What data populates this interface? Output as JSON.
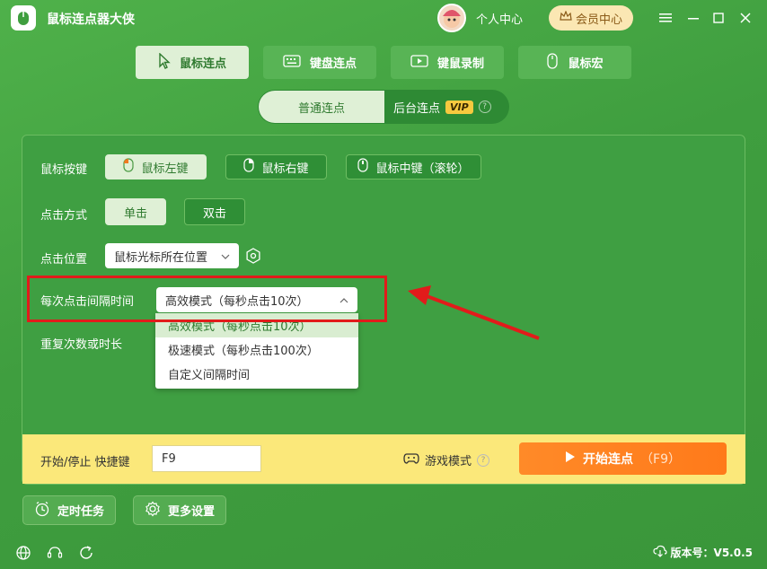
{
  "app": {
    "title": "鼠标连点器大侠"
  },
  "header": {
    "personal_center": "个人中心",
    "vip_center": "会员中心"
  },
  "main_tabs": [
    {
      "label": "鼠标连点",
      "icon": "cursor-icon",
      "active": true
    },
    {
      "label": "键盘连点",
      "icon": "keyboard-icon",
      "active": false
    },
    {
      "label": "键鼠录制",
      "icon": "video-icon",
      "active": false
    },
    {
      "label": "鼠标宏",
      "icon": "mouse-icon",
      "active": false
    }
  ],
  "sub_tabs": {
    "normal": "普通连点",
    "background": "后台连点",
    "vip_badge": "VIP"
  },
  "panel": {
    "mouse_button": {
      "label": "鼠标按键",
      "options": [
        "鼠标左键",
        "鼠标右键",
        "鼠标中键（滚轮）"
      ],
      "selected": "鼠标左键"
    },
    "click_type": {
      "label": "点击方式",
      "options": [
        "单击",
        "双击"
      ],
      "selected": "单击"
    },
    "click_position": {
      "label": "点击位置",
      "value": "鼠标光标所在位置"
    },
    "interval": {
      "label": "每次点击间隔时间",
      "value": "高效模式（每秒点击10次）",
      "options": [
        "高效模式（每秒点击10次）",
        "极速模式（每秒点击100次）",
        "自定义间隔时间"
      ]
    },
    "repeat": {
      "label": "重复次数或时长"
    }
  },
  "bottom_bar": {
    "hotkey_label": "开始/停止 快捷键",
    "hotkey_value": "F9",
    "game_mode": "游戏模式",
    "start_label": "开始连点",
    "start_hint": "（F9）"
  },
  "footer": {
    "timer_task": "定时任务",
    "more_settings": "更多设置",
    "version": "版本号：V5.0.5"
  },
  "colors": {
    "accent": "#3f9e3f",
    "start": "#ff7a1a",
    "highlight": "#e21b1b"
  }
}
